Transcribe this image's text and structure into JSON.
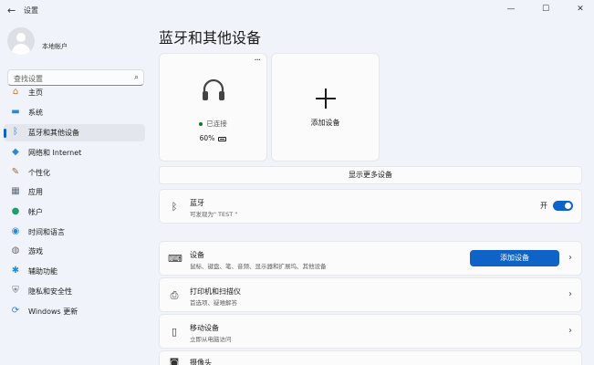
{
  "window": {
    "back_icon": "back-arrow-icon",
    "title": "设置",
    "controls": [
      "—",
      "☐",
      "✕"
    ]
  },
  "sidebar": {
    "account_name": "本地帐户",
    "search_placeholder": "查找设置",
    "items": [
      {
        "label": "主页",
        "icon": "home-icon",
        "glyph": "⌂",
        "color": "#c97a2e",
        "active": false
      },
      {
        "label": "系统",
        "icon": "monitor-icon",
        "glyph": "▬",
        "color": "#2b88d8",
        "active": false
      },
      {
        "label": "蓝牙和其他设备",
        "icon": "bluetooth-icon",
        "glyph": "ᛒ",
        "color": "#2b88d8",
        "active": true
      },
      {
        "label": "网络和 Internet",
        "icon": "wifi-icon",
        "glyph": "◆",
        "color": "#2b88d8",
        "active": false
      },
      {
        "label": "个性化",
        "icon": "brush-icon",
        "glyph": "✎",
        "color": "#9a6a3a",
        "active": false
      },
      {
        "label": "应用",
        "icon": "apps-icon",
        "glyph": "▦",
        "color": "#5c6b7a",
        "active": false
      },
      {
        "label": "帐户",
        "icon": "person-icon",
        "glyph": "●",
        "color": "#1f9e6c",
        "active": false
      },
      {
        "label": "时间和语言",
        "icon": "globe-icon",
        "glyph": "◉",
        "color": "#2b88d8",
        "active": false
      },
      {
        "label": "游戏",
        "icon": "gamepad-icon",
        "glyph": "◍",
        "color": "#6b6b6b",
        "active": false
      },
      {
        "label": "辅助功能",
        "icon": "accessibility-icon",
        "glyph": "✱",
        "color": "#2b88d8",
        "active": false
      },
      {
        "label": "隐私和安全性",
        "icon": "shield-icon",
        "glyph": "⛨",
        "color": "#6b7580",
        "active": false
      },
      {
        "label": "Windows 更新",
        "icon": "update-icon",
        "glyph": "⟳",
        "color": "#2b88d8",
        "active": false
      }
    ]
  },
  "main": {
    "title": "蓝牙和其他设备",
    "device_card": {
      "icon": "headphones-icon",
      "more_icon": "more-icon",
      "status": "已连接",
      "battery_text": "60%",
      "battery_level": 0.6
    },
    "add_card": {
      "icon": "plus-icon",
      "label": "添加设备"
    },
    "show_more": "显示更多设备",
    "bluetooth_row": {
      "icon": "bluetooth-icon",
      "title": "蓝牙",
      "subtitle": "可发现为\" TEST \"",
      "toggle_label": "开",
      "toggle_on": true
    },
    "devices_row": {
      "icon": "keyboard-icon",
      "title": "设备",
      "subtitle": "鼠标、键盘、笔、音频、显示器和扩展坞、其他设备",
      "button_label": "添加设备"
    },
    "printers_row": {
      "icon": "printer-icon",
      "title": "打印机和扫描仪",
      "subtitle": "首选项、疑难解答"
    },
    "mobile_row": {
      "icon": "phone-icon",
      "title": "移动设备",
      "subtitle": "立即从电脑访问"
    },
    "camera_row": {
      "icon": "camera-icon",
      "title": "摄像头"
    },
    "chevron": "›"
  },
  "colors": {
    "accent": "#0f62c6",
    "background": "#f0f3f9",
    "card": "#fbfbfc",
    "connected": "#107c10"
  }
}
